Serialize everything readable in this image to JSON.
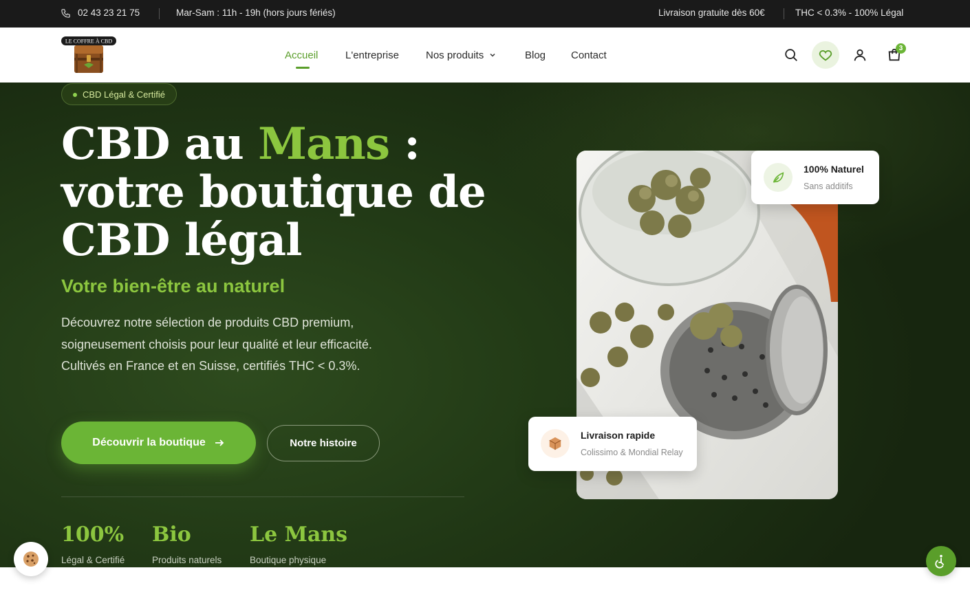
{
  "topbar": {
    "phone": "02 43 23 21 75",
    "hours": "Mar-Sam : 11h - 19h (hors jours fériés)",
    "shipping": "Livraison gratuite dès 60€",
    "legal": "THC < 0.3% - 100% Légal"
  },
  "logo": {
    "text": "LE COFFRE À CBD"
  },
  "nav": {
    "items": [
      {
        "label": "Accueil",
        "active": true
      },
      {
        "label": "L'entreprise"
      },
      {
        "label": "Nos produits",
        "has_dropdown": true
      },
      {
        "label": "Blog"
      },
      {
        "label": "Contact"
      }
    ],
    "icons": [
      "search-icon",
      "heart-icon",
      "user-icon",
      "cart-icon"
    ],
    "cart_count": "3"
  },
  "hero": {
    "badge": "CBD Légal & Certifié",
    "title_part1": "CBD au ",
    "title_accent": "Mans",
    "title_part2": " :",
    "title_line2": "votre boutique de",
    "title_line3": "CBD légal",
    "subtitle": "Votre bien-être au naturel",
    "description": "Découvrez notre sélection de produits CBD premium, soigneusement choisis pour leur qualité et leur efficacité. Cultivés en France et en Suisse, certifiés THC < 0.3%.",
    "cta_primary": "Découvrir la boutique",
    "cta_secondary": "Notre histoire",
    "stats": [
      {
        "value": "100%",
        "label": "Légal & Certifié"
      },
      {
        "value": "Bio",
        "label": "Produits naturels"
      },
      {
        "value": "Le Mans",
        "label": "Boutique physique"
      }
    ]
  },
  "cards": {
    "natural": {
      "title": "100% Naturel",
      "subtitle": "Sans additifs"
    },
    "delivery": {
      "title": "Livraison rapide",
      "subtitle": "Colissimo & Mondial Relay"
    }
  },
  "colors": {
    "accent": "#8cc63f",
    "brand_green": "#6bb536",
    "dark": "#1a1a1a",
    "hero_bg": "#223a16"
  }
}
